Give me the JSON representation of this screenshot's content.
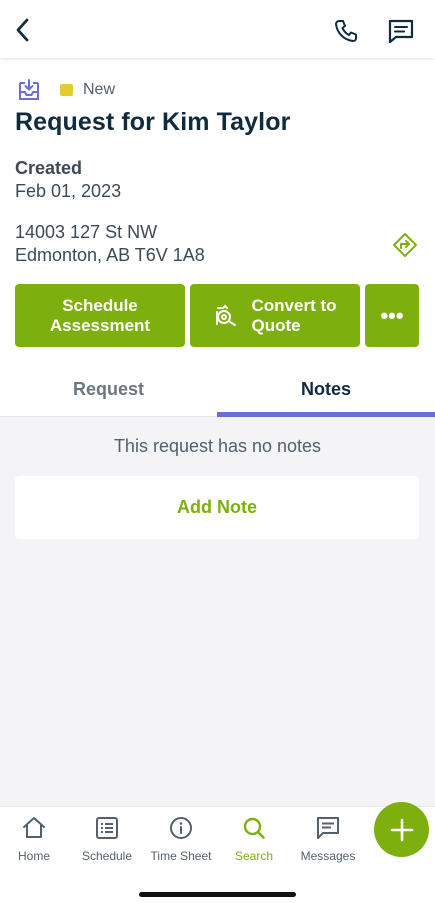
{
  "status": {
    "label": "New",
    "color": "#e2cc2d"
  },
  "request": {
    "title": "Request for Kim Taylor",
    "created_label": "Created",
    "created_date": "Feb 01, 2023",
    "address_line1": "14003 127 St NW",
    "address_line2": "Edmonton, AB T6V 1A8"
  },
  "actions": {
    "schedule_line1": "Schedule",
    "schedule_line2": "Assessment",
    "convert_line1": "Convert to",
    "convert_line2": "Quote",
    "more": "•••"
  },
  "tabs": [
    {
      "label": "Request",
      "active": false
    },
    {
      "label": "Notes",
      "active": true
    }
  ],
  "notes": {
    "empty_message": "This request has no notes",
    "add_label": "Add Note"
  },
  "nav": [
    {
      "label": "Home",
      "icon": "home-icon",
      "active": false
    },
    {
      "label": "Schedule",
      "icon": "schedule-icon",
      "active": false
    },
    {
      "label": "Time Sheet",
      "icon": "clock-icon",
      "active": false
    },
    {
      "label": "Search",
      "icon": "search-icon",
      "active": true
    },
    {
      "label": "Messages",
      "icon": "messages-icon",
      "active": false
    }
  ],
  "colors": {
    "brand_green": "#7db00e",
    "tab_accent": "#6b6fd3",
    "title": "#0f2b3d"
  }
}
